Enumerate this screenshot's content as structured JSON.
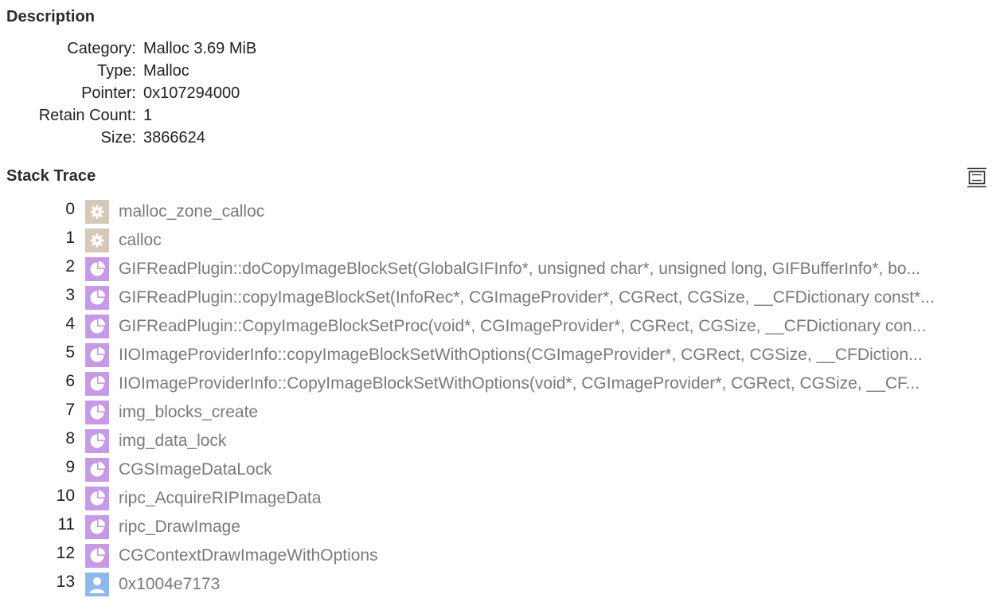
{
  "description": {
    "title": "Description",
    "fields": [
      {
        "label": "Category:",
        "value": "Malloc 3.69 MiB"
      },
      {
        "label": "Type:",
        "value": "Malloc"
      },
      {
        "label": "Pointer:",
        "value": "0x107294000"
      },
      {
        "label": "Retain Count:",
        "value": "1"
      },
      {
        "label": "Size:",
        "value": "3866624"
      }
    ]
  },
  "stack_trace": {
    "title": "Stack Trace",
    "expand_icon": "expand-collapse-icon",
    "frames": [
      {
        "index": "0",
        "icon": "gear",
        "symbol": "malloc_zone_calloc"
      },
      {
        "index": "1",
        "icon": "gear",
        "symbol": "calloc"
      },
      {
        "index": "2",
        "icon": "pie",
        "symbol": "GIFReadPlugin::doCopyImageBlockSet(GlobalGIFInfo*, unsigned char*, unsigned long, GIFBufferInfo*, bo..."
      },
      {
        "index": "3",
        "icon": "pie",
        "symbol": "GIFReadPlugin::copyImageBlockSet(InfoRec*, CGImageProvider*, CGRect, CGSize, __CFDictionary const*..."
      },
      {
        "index": "4",
        "icon": "pie",
        "symbol": "GIFReadPlugin::CopyImageBlockSetProc(void*, CGImageProvider*, CGRect, CGSize, __CFDictionary con..."
      },
      {
        "index": "5",
        "icon": "pie",
        "symbol": "IIOImageProviderInfo::copyImageBlockSetWithOptions(CGImageProvider*, CGRect, CGSize, __CFDiction..."
      },
      {
        "index": "6",
        "icon": "pie",
        "symbol": "IIOImageProviderInfo::CopyImageBlockSetWithOptions(void*, CGImageProvider*, CGRect, CGSize, __CF..."
      },
      {
        "index": "7",
        "icon": "pie",
        "symbol": "img_blocks_create"
      },
      {
        "index": "8",
        "icon": "pie",
        "symbol": "img_data_lock"
      },
      {
        "index": "9",
        "icon": "pie",
        "symbol": "CGSImageDataLock"
      },
      {
        "index": "10",
        "icon": "pie",
        "symbol": "ripc_AcquireRIPImageData"
      },
      {
        "index": "11",
        "icon": "pie",
        "symbol": "ripc_DrawImage"
      },
      {
        "index": "12",
        "icon": "pie",
        "symbol": "CGContextDrawImageWithOptions"
      },
      {
        "index": "13",
        "icon": "user",
        "symbol": "0x1004e7173"
      }
    ]
  },
  "colors": {
    "gear_bg": "#d6c8b8",
    "pie_bg": "#c79ae8",
    "user_bg": "#8fb8ec",
    "symbol_text": "#7a7a7a"
  }
}
